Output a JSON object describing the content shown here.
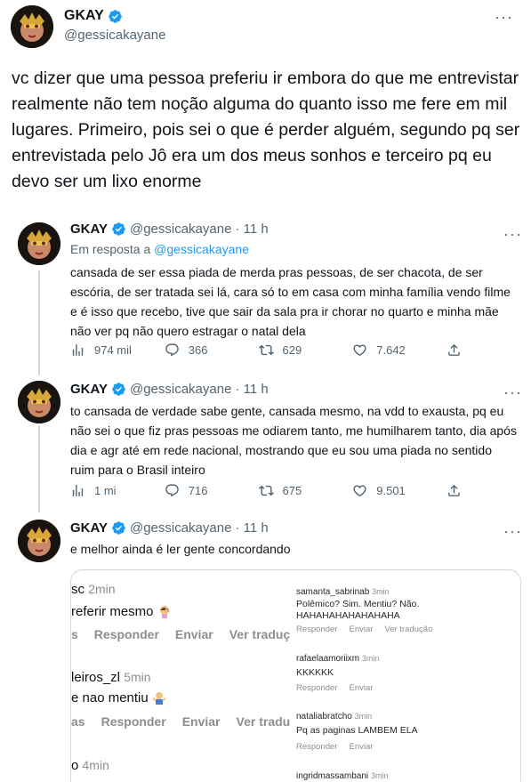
{
  "main_tweet": {
    "name": "GKAY",
    "handle": "@gessicakayane",
    "text": "vc dizer que uma pessoa preferiu ir embora do que me entrevistar realmente não tem noção alguma do quanto isso me fere em mil lugares. Primeiro, pois sei o que é perder alguém, segundo pq ser entrevistada pelo Jô era um dos meus sonhos e terceiro pq eu devo ser um lixo enorme"
  },
  "replies": [
    {
      "name": "GKAY",
      "handle": "@gessicakayane",
      "time": "· 11 h",
      "reply_prefix": "Em resposta a ",
      "reply_to": "@gessicakayane",
      "text": "cansada de ser essa piada de merda pras pessoas, de ser chacota, de ser escória, de ser tratada sei lá, cara só to em casa com minha família vendo filme e é isso que recebo, tive que sair da sala pra ir chorar no quarto e minha mãe não ver pq não quero estragar o natal dela",
      "views": "974 mil",
      "replies": "366",
      "retweets": "629",
      "likes": "7.642"
    },
    {
      "name": "GKAY",
      "handle": "@gessicakayane",
      "time": "· 11 h",
      "text": "to cansada de verdade sabe gente, cansada mesmo, na vdd to exausta, pq eu não sei o que fiz pras pessoas me odiarem tanto, me humilharem tanto, dia após dia e agr até em rede nacional, mostrando que eu sou uma piada no sentido ruim para o Brasil inteiro",
      "views": "1 mi",
      "replies": "716",
      "retweets": "675",
      "likes": "9.501"
    },
    {
      "name": "GKAY",
      "handle": "@gessicakayane",
      "time": "· 11 h",
      "text": "e melhor ainda é ler gente concordando"
    }
  ],
  "embed": {
    "left": [
      {
        "user": "sc",
        "time": "2min",
        "text": "referir mesmo",
        "actions": [
          "s",
          "Responder",
          "Enviar",
          "Ver traduç"
        ]
      },
      {
        "user": "leiros_zl",
        "time": "5min",
        "text": "e nao mentiu",
        "actions": [
          "as",
          "Responder",
          "Enviar",
          "Ver tradu"
        ]
      },
      {
        "user": "o",
        "time": "4min"
      }
    ],
    "right": [
      {
        "user": "samanta_sabrinab",
        "time": "3min",
        "lines": [
          "Polêmico? Sim. Mentiu? Não.",
          "HAHAHAHAHAHAHAHA"
        ],
        "actions": [
          "Responder",
          "Enviar",
          "Ver tradução"
        ]
      },
      {
        "user": "rafaelaamoriixm",
        "time": "3min",
        "lines": [
          "KKKKKK"
        ],
        "actions": [
          "Responder",
          "Enviar"
        ]
      },
      {
        "user": "nataliabratcho",
        "time": "3min",
        "lines": [
          "Pq as paginas LAMBEM ELA"
        ],
        "actions": [
          "Responder",
          "Enviar"
        ]
      },
      {
        "user": "ingridmassambani",
        "time": "3min"
      }
    ]
  },
  "colors": {
    "accent": "#1d9bf0",
    "secondary_text": "#536471",
    "thread_line": "#cfd9de"
  }
}
